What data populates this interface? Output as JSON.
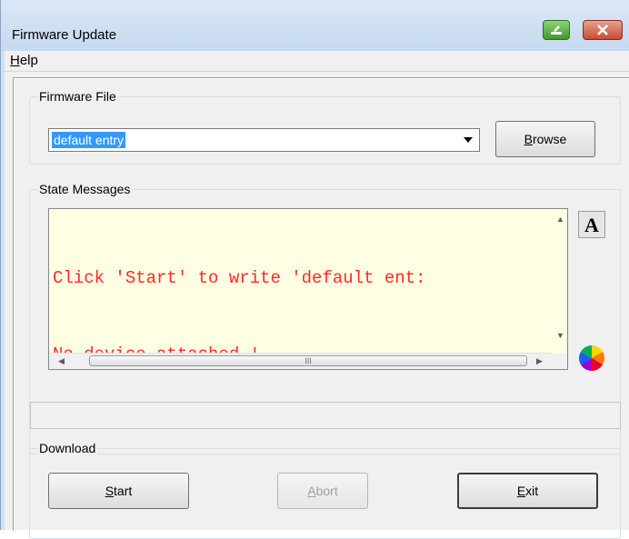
{
  "window": {
    "title": "Firmware Update"
  },
  "menu": {
    "help_accel": "H",
    "help_rest": "elp"
  },
  "firmware_file": {
    "legend": "Firmware File",
    "selected": "default entry",
    "browse_accel": "B",
    "browse_rest": "rowse"
  },
  "state_messages": {
    "legend": "State Messages",
    "lines": [
      "Click 'Start' to write 'default ent:",
      "No device attached !"
    ],
    "scroll_grip": "III"
  },
  "download": {
    "legend": "Download",
    "start_accel": "S",
    "start_rest": "tart",
    "abort_accel": "A",
    "abort_rest": "bort",
    "exit_accel": "E",
    "exit_rest": "xit"
  },
  "icons": {
    "restore": "restore-icon",
    "close": "close-icon",
    "dropdown": "chevron-down-icon",
    "font": "font-icon",
    "color": "color-wheel-icon"
  },
  "colors": {
    "message_text": "#ff2a2a",
    "message_bg": "#ffffe3",
    "selection": "#3399ff"
  }
}
